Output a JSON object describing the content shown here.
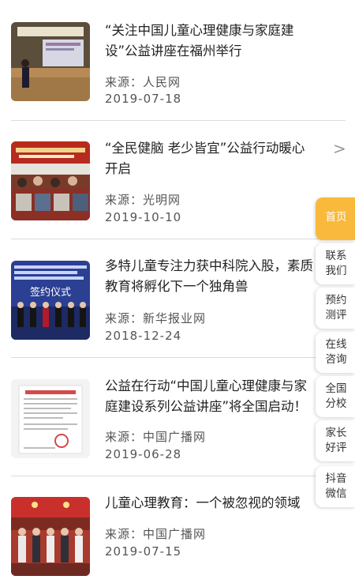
{
  "news": [
    {
      "title": "“关注中国儿童心理健康与家庭建设”公益讲座在福州举行",
      "source": "来源：人民网",
      "date": "2019-07-18",
      "thumb_icon": "lecture-photo"
    },
    {
      "title": "“全民健脑 老少皆宜”公益行动暖心开启",
      "source": "来源：光明网",
      "date": "2019-10-10",
      "thumb_icon": "event-banner-photo"
    },
    {
      "title": "多特儿童专注力获中科院入股，素质教育将孵化下一个独角兽",
      "source": "来源：新华报业网",
      "date": "2018-12-24",
      "thumb_icon": "signing-ceremony-photo",
      "thumb_text": "签约仪式"
    },
    {
      "title": "公益在行动“中国儿童心理健康与家庭建设系列公益讲座”将全国启动！",
      "source": "来源：中国广播网",
      "date": "2019-06-28",
      "thumb_icon": "document-photo"
    },
    {
      "title": "儿童心理教育：一个被忽视的领域",
      "source": "来源：中国广播网",
      "date": "2019-07-15",
      "thumb_icon": "group-photo"
    }
  ],
  "chevron": ">",
  "side_nav": [
    {
      "label": "首页",
      "active": true
    },
    {
      "label": "联系我们",
      "active": false
    },
    {
      "label": "预约测评",
      "active": false
    },
    {
      "label": "在线咨询",
      "active": false
    },
    {
      "label": "全国分校",
      "active": false
    },
    {
      "label": "家长好评",
      "active": false
    },
    {
      "label": "抖音微信",
      "active": false
    }
  ],
  "colors": {
    "accent": "#f9b93c",
    "divider": "#dcdcdc"
  }
}
